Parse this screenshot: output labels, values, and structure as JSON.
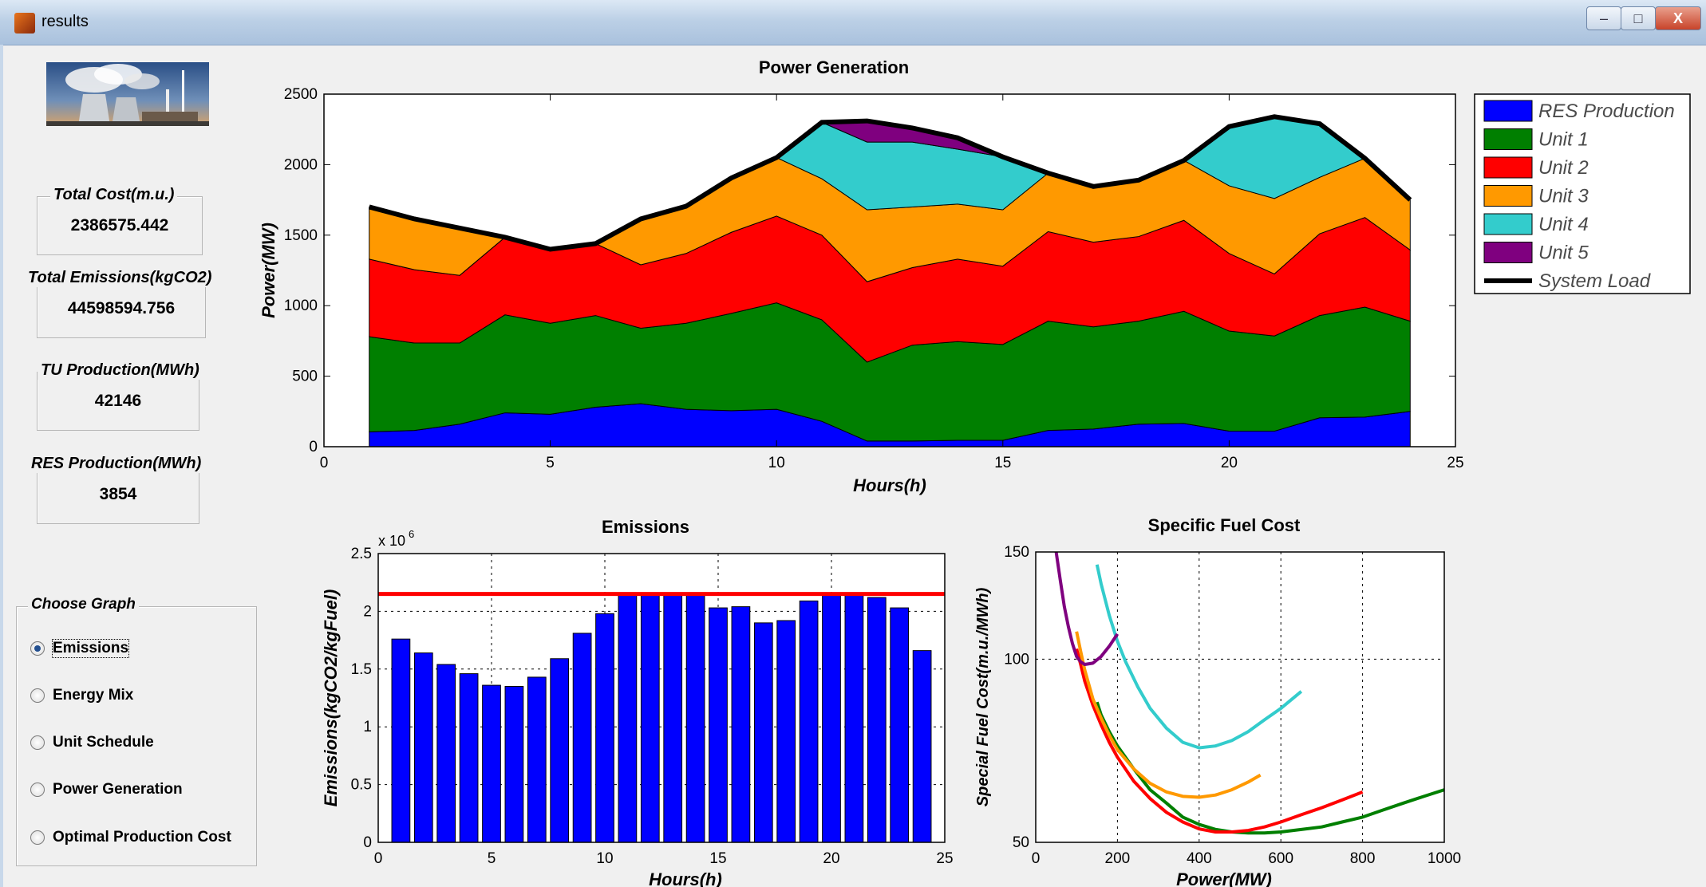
{
  "window": {
    "title": "results",
    "min_label": "–",
    "max_label": "□",
    "close_label": "X"
  },
  "stats": [
    {
      "label": "Total Cost(m.u.)",
      "value": "2386575.442"
    },
    {
      "label": "Total Emissions(kgCO2)",
      "value": "44598594.756"
    },
    {
      "label": "TU Production(MWh)",
      "value": "42146"
    },
    {
      "label": "RES Production(MWh)",
      "value": "3854"
    }
  ],
  "choose_graph": {
    "title": "Choose Graph",
    "options": [
      {
        "label": "Emissions",
        "selected": true
      },
      {
        "label": "Energy Mix",
        "selected": false
      },
      {
        "label": "Unit Schedule",
        "selected": false
      },
      {
        "label": "Power Generation",
        "selected": false
      },
      {
        "label": "Optimal Production Cost",
        "selected": false
      }
    ]
  },
  "chart_data": [
    {
      "type": "area",
      "title": "Power Generation",
      "xlabel": "Hours(h)",
      "ylabel": "Power(MW)",
      "xlim": [
        0,
        25
      ],
      "ylim": [
        0,
        2500
      ],
      "xticks": [
        0,
        5,
        10,
        15,
        20,
        25
      ],
      "yticks": [
        0,
        500,
        1000,
        1500,
        2000,
        2500
      ],
      "grid": false,
      "legend_position": "outside-right",
      "x": [
        1,
        2,
        3,
        4,
        5,
        6,
        7,
        8,
        9,
        10,
        11,
        12,
        13,
        14,
        15,
        16,
        17,
        18,
        19,
        20,
        21,
        22,
        23,
        24
      ],
      "series": [
        {
          "name": "RES Production",
          "color": "#0000ff",
          "values": [
            105,
            115,
            160,
            240,
            230,
            280,
            305,
            265,
            255,
            265,
            180,
            40,
            40,
            45,
            45,
            115,
            125,
            160,
            165,
            110,
            110,
            205,
            210,
            250
          ]
        },
        {
          "name": "Unit 1",
          "color": "#007f00",
          "values": [
            675,
            620,
            575,
            695,
            645,
            650,
            535,
            610,
            690,
            755,
            720,
            560,
            680,
            700,
            680,
            775,
            725,
            730,
            795,
            710,
            675,
            725,
            780,
            640
          ]
        },
        {
          "name": "Unit 2",
          "color": "#ff0000",
          "values": [
            550,
            520,
            480,
            550,
            525,
            510,
            450,
            495,
            575,
            615,
            600,
            570,
            550,
            585,
            555,
            635,
            600,
            600,
            645,
            550,
            440,
            580,
            635,
            505
          ]
        },
        {
          "name": "Unit 3",
          "color": "#ff9900",
          "values": [
            370,
            360,
            335,
            0,
            0,
            0,
            325,
            335,
            385,
            415,
            400,
            510,
            430,
            390,
            400,
            415,
            395,
            400,
            425,
            480,
            535,
            400,
            420,
            355
          ]
        },
        {
          "name": "Unit 4",
          "color": "#33cccc",
          "values": [
            0,
            0,
            0,
            0,
            0,
            0,
            0,
            0,
            0,
            0,
            400,
            480,
            460,
            390,
            375,
            0,
            0,
            0,
            0,
            420,
            580,
            380,
            0,
            0
          ]
        },
        {
          "name": "Unit 5",
          "color": "#7f007f",
          "values": [
            0,
            0,
            0,
            0,
            0,
            0,
            0,
            0,
            0,
            0,
            0,
            150,
            100,
            80,
            0,
            0,
            0,
            0,
            0,
            0,
            0,
            0,
            0,
            0
          ]
        },
        {
          "name": "System Load",
          "color": "#000000",
          "style": "line",
          "values": [
            1700,
            1615,
            1550,
            1485,
            1400,
            1440,
            1615,
            1705,
            1905,
            2050,
            2300,
            2310,
            2260,
            2190,
            2055,
            1940,
            1845,
            1890,
            2030,
            2270,
            2340,
            2290,
            2045,
            1750
          ]
        }
      ]
    },
    {
      "type": "bar",
      "title": "Emissions",
      "xlabel": "Hours(h)",
      "ylabel": "Emissions(kgCO2/kgFuel)",
      "exponent_label": "x 10",
      "exponent_power": "6",
      "xlim": [
        0,
        25
      ],
      "ylim": [
        0,
        2.5
      ],
      "xticks": [
        0,
        5,
        10,
        15,
        20,
        25
      ],
      "yticks": [
        0,
        0.5,
        1,
        1.5,
        2,
        2.5
      ],
      "grid": true,
      "bar_color": "#0000ff",
      "limit_line": 2.15,
      "limit_color": "#ff0000",
      "x": [
        1,
        2,
        3,
        4,
        5,
        6,
        7,
        8,
        9,
        10,
        11,
        12,
        13,
        14,
        15,
        16,
        17,
        18,
        19,
        20,
        21,
        22,
        23,
        24
      ],
      "values": [
        1.76,
        1.64,
        1.54,
        1.46,
        1.36,
        1.35,
        1.43,
        1.59,
        1.81,
        1.98,
        2.15,
        2.15,
        2.15,
        2.14,
        2.03,
        2.04,
        1.9,
        1.92,
        2.09,
        2.15,
        2.14,
        2.12,
        2.03,
        1.66
      ]
    },
    {
      "type": "line",
      "title": "Specific Fuel Cost",
      "xlabel": "Power(MW)",
      "ylabel": "Special Fuel Cost(m.u./MWh)",
      "xlim": [
        0,
        1000
      ],
      "ylim": [
        50,
        150
      ],
      "xticks": [
        0,
        200,
        400,
        600,
        800,
        1000
      ],
      "yticks": [
        50,
        100,
        150
      ],
      "log_y": true,
      "grid": true,
      "series": [
        {
          "color": "#007f00",
          "x": [
            150,
            160,
            180,
            200,
            240,
            280,
            320,
            360,
            400,
            440,
            480,
            520,
            560,
            600,
            650,
            700,
            750,
            800,
            850,
            900,
            950,
            1000
          ],
          "y": [
            85,
            81,
            76,
            72,
            66,
            61,
            58,
            55,
            53.5,
            52.5,
            52,
            51.8,
            51.8,
            52,
            52.5,
            53,
            54,
            55,
            56.5,
            58,
            59.5,
            61
          ]
        },
        {
          "color": "#ff0000",
          "x": [
            100,
            110,
            120,
            140,
            160,
            180,
            200,
            240,
            280,
            320,
            360,
            400,
            440,
            480,
            520,
            560,
            600,
            650,
            700,
            750,
            800
          ],
          "y": [
            104,
            98,
            92,
            84,
            78,
            73,
            69,
            63,
            59,
            56,
            54,
            52.6,
            52,
            52,
            52.3,
            53,
            54,
            55.5,
            57,
            58.7,
            60.5
          ]
        },
        {
          "color": "#ff9900",
          "x": [
            100,
            110,
            120,
            140,
            160,
            180,
            200,
            240,
            280,
            320,
            360,
            400,
            440,
            480,
            520,
            550
          ],
          "y": [
            111,
            103,
            96,
            86,
            80,
            75,
            71,
            66,
            62.5,
            60.5,
            59.5,
            59.3,
            59.8,
            61,
            62.8,
            64.5
          ]
        },
        {
          "color": "#33cccc",
          "x": [
            150,
            160,
            180,
            200,
            220,
            250,
            280,
            320,
            360,
            400,
            440,
            480,
            520,
            560,
            600,
            650
          ],
          "y": [
            143,
            133,
            118,
            107,
            99,
            90,
            83,
            77,
            73,
            71.5,
            72,
            73.5,
            76,
            79.5,
            83,
            88.5
          ]
        },
        {
          "color": "#7f007f",
          "x": [
            50,
            60,
            70,
            80,
            90,
            100,
            110,
            120,
            140,
            160,
            180,
            200
          ],
          "y": [
            150,
            135,
            122,
            113,
            106,
            101,
            99,
            98,
            98.5,
            101,
            105,
            110
          ]
        }
      ]
    }
  ]
}
